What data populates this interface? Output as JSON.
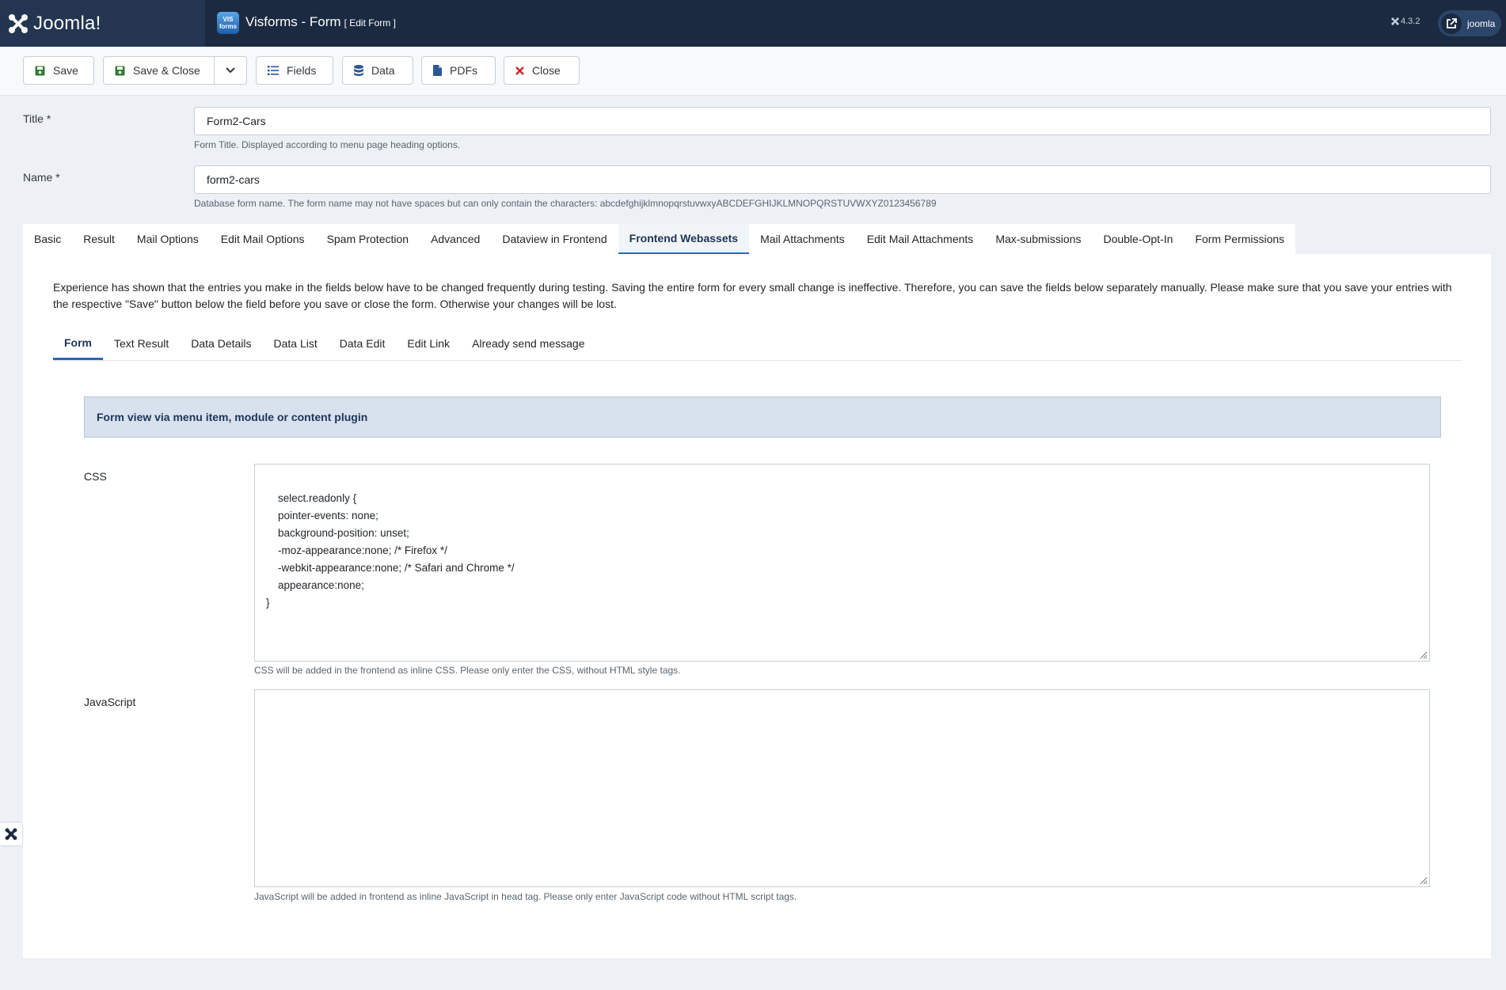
{
  "header": {
    "logo_text": "Joomla!",
    "app_icon_top": "VIS",
    "app_icon_bottom": "forms",
    "title": "Visforms - Form",
    "subtitle": "[ Edit Form ]",
    "version": "4.3.2",
    "user_label": "joomla"
  },
  "toolbar": {
    "save": "Save",
    "save_close": "Save & Close",
    "fields": "Fields",
    "data": "Data",
    "pdfs": "PDFs",
    "close": "Close"
  },
  "form": {
    "title_label": "Title *",
    "title_value": "Form2-Cars",
    "title_help": "Form Title. Displayed according to menu page heading options.",
    "name_label": "Name *",
    "name_value": "form2-cars",
    "name_help": "Database form name. The form name may not have spaces but can only contain the characters: abcdefghijklmnopqrstuvwxyABCDEFGHIJKLMNOPQRSTUVWXYZ0123456789"
  },
  "tabs": [
    "Basic",
    "Result",
    "Mail Options",
    "Edit Mail Options",
    "Spam Protection",
    "Advanced",
    "Dataview in Frontend",
    "Frontend Webassets",
    "Mail Attachments",
    "Edit Mail Attachments",
    "Max-submissions",
    "Double-Opt-In",
    "Form Permissions"
  ],
  "active_tab": "Frontend Webassets",
  "panel": {
    "intro": "Experience has shown that the entries you make in the fields below have to be changed frequently during testing. Saving the entire form for every small change is ineffective. Therefore, you can save the fields below separately manually. Please make sure that you save your entries with the respective \"Save\" button below the field before you save or close the form. Otherwise your changes will be lost.",
    "subtabs": [
      "Form",
      "Text Result",
      "Data Details",
      "Data List",
      "Data Edit",
      "Edit Link",
      "Already send message"
    ],
    "active_subtab": "Form",
    "info": "Form view via menu item, module or content plugin",
    "css_label": "CSS",
    "css_value": "select.readonly {\n    pointer-events: none;\n    background-position: unset;\n    -moz-appearance:none; /* Firefox */\n    -webkit-appearance:none; /* Safari and Chrome */\n    appearance:none;\n}",
    "css_help": "CSS will be added in the frontend as inline CSS. Please only enter the CSS, without HTML style tags.",
    "js_label": "JavaScript",
    "js_value": "",
    "js_help": "JavaScript will be added in frontend as inline JavaScript in head tag. Please only enter JavaScript code without HTML script tags."
  },
  "colors": {
    "header_bg": "#1b2a40",
    "accent": "#2a69b8",
    "save_green": "#2e7d32",
    "close_red": "#c62828",
    "icon_blue": "#2b5797"
  }
}
